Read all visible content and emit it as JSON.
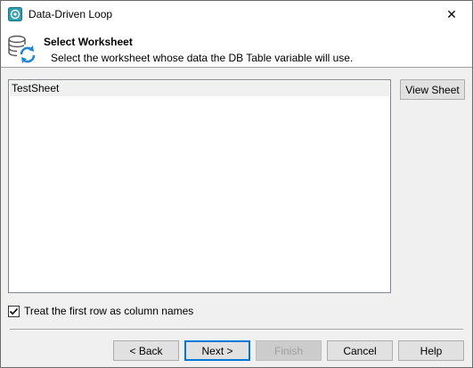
{
  "window": {
    "title": "Data-Driven Loop",
    "close_glyph": "✕"
  },
  "header": {
    "title": "Select Worksheet",
    "description": "Select the worksheet whose data the DB Table variable will use.",
    "icon": "database-refresh-icon"
  },
  "worksheets": {
    "items": [
      "TestSheet"
    ],
    "selected": "TestSheet"
  },
  "buttons": {
    "view_sheet": "View Sheet",
    "back": "< Back",
    "next": "Next >",
    "finish": "Finish",
    "cancel": "Cancel",
    "help": "Help"
  },
  "options": {
    "first_row_header_label": "Treat the first row as column names",
    "first_row_header_checked": true
  },
  "colors": {
    "accent": "#0078d7",
    "icon_teal": "#2a9fb0"
  }
}
